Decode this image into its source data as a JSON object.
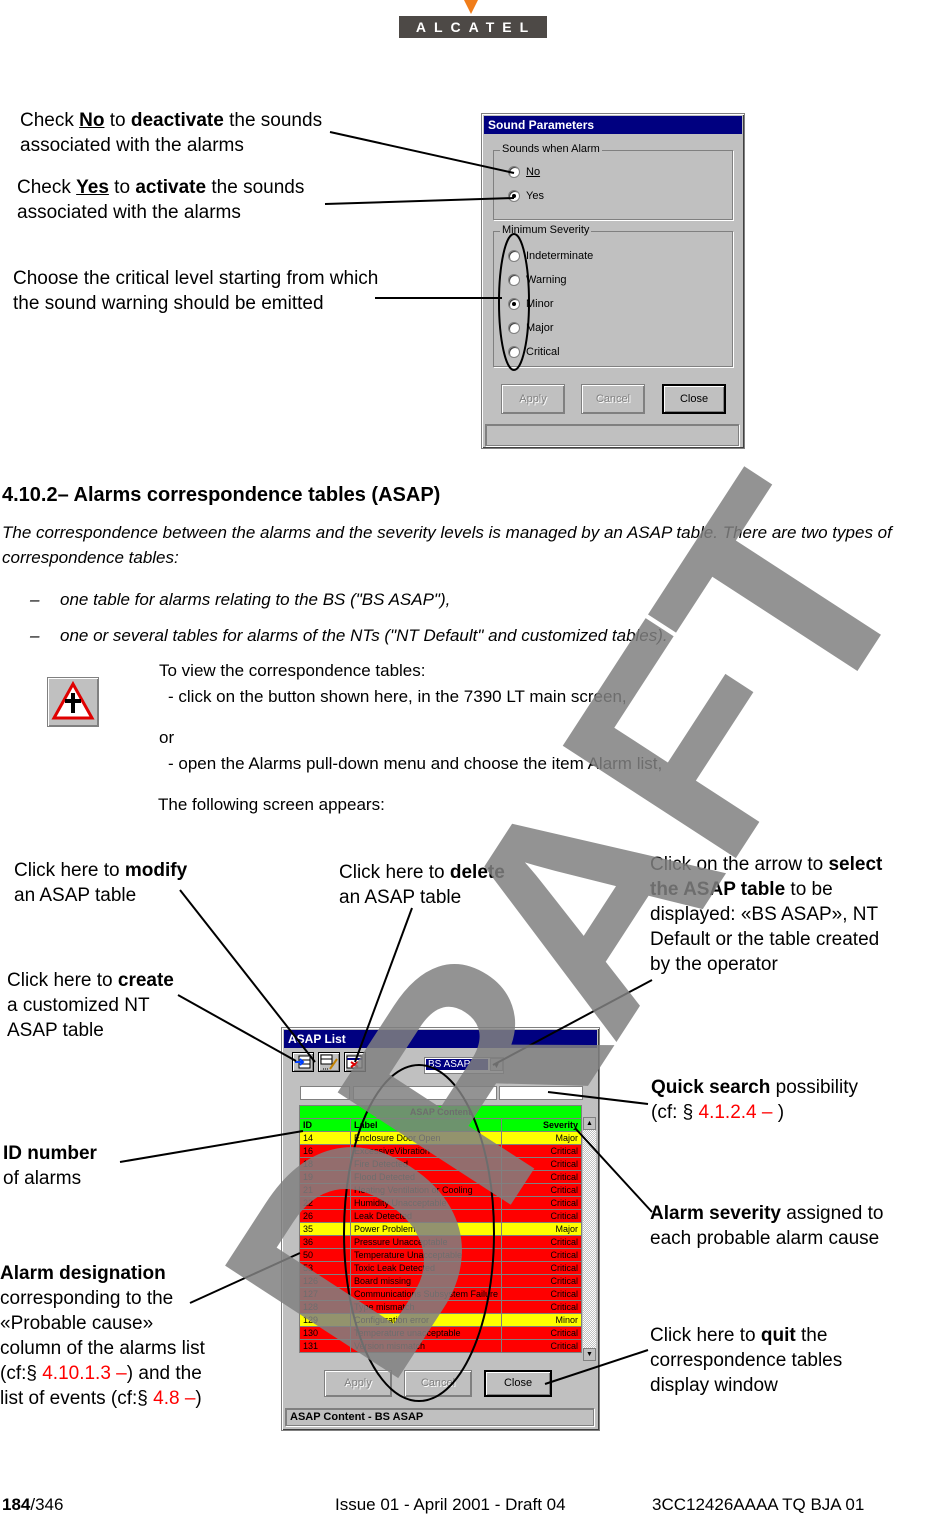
{
  "header": {
    "logo_text": "ALCATEL"
  },
  "sound_parameters_window": {
    "title": "Sound Parameters",
    "sounds_group_label": "Sounds when Alarm",
    "sounds_options": [
      {
        "label": "No",
        "selected": false
      },
      {
        "label": "Yes",
        "selected": true
      }
    ],
    "severity_group_label": "Minimum Severity",
    "severity_options": [
      {
        "label": "Indeterminate",
        "selected": false
      },
      {
        "label": "Warning",
        "selected": false
      },
      {
        "label": "Minor",
        "selected": true
      },
      {
        "label": "Major",
        "selected": false
      },
      {
        "label": "Critical",
        "selected": false
      }
    ],
    "buttons": {
      "apply": "Apply",
      "cancel": "Cancel",
      "close": "Close"
    },
    "status_text": ""
  },
  "callouts_top": {
    "no": {
      "pre": "Check ",
      "key": "No",
      "mid": " to ",
      "bold": "deactivate",
      "post": " the sounds",
      "line2": "associated with the alarms"
    },
    "yes": {
      "pre": "Check ",
      "key": "Yes",
      "mid": " to ",
      "bold": "activate",
      "post": " the sounds",
      "line2": "associated with the alarms"
    },
    "level": {
      "line1": "Choose the critical level starting from which",
      "line2": "the sound warning should be emitted"
    }
  },
  "section": {
    "heading": "4.10.2– Alarms correspondence tables (ASAP)",
    "intro": "The correspondence between the alarms and the severity levels is managed by an ASAP table. There are two types of correspondence tables:",
    "bullets": [
      "one table for alarms relating to the BS (\"BS ASAP\"),",
      "one or several tables for alarms of the NTs (\"NT Default\" and customized tables)."
    ],
    "bullet_dash": "–",
    "instructions": {
      "line1": "To view the correspondence tables:",
      "line2": "- click on the button shown here, in the 7390 LT main screen,",
      "or": "or",
      "line3": "- open the Alarms pull-down menu and choose the item Alarm list,",
      "line4": "The following screen appears:"
    }
  },
  "callouts_bottom": {
    "modify": {
      "pre": "Click here to ",
      "bold": "modify",
      "line2": "an ASAP table"
    },
    "delete": {
      "pre": "Click here to ",
      "bold": "delete",
      "line2": "an ASAP table"
    },
    "create": {
      "pre": "Click here to ",
      "bold": "create",
      "line2": "a customized NT",
      "line3": "ASAP table"
    },
    "select": {
      "pre": "Click on the arrow to ",
      "bold1": "select",
      "bold2": "the ASAP table",
      "post2": " to be",
      "line3": "displayed: «BS ASAP», NT",
      "line4": "Default or the table created",
      "line5": "by the operator"
    },
    "quick": {
      "bold": "Quick search",
      "post": " possibility",
      "line2_pre": "(cf: § ",
      "ref": "4.1.2.4 –",
      "line2_post": " )"
    },
    "id": {
      "bold": "ID number",
      "line2": "of alarms"
    },
    "severity": {
      "bold": "Alarm severity",
      "post": "  assigned to",
      "line2": "each probable alarm cause"
    },
    "designation": {
      "bold": "Alarm designation",
      "line2": "corresponding to the",
      "line3": "«Probable cause»",
      "line4": "column of the alarms list",
      "line5_pre": "(cf:§ ",
      "ref1": "4.10.1.3 –",
      "line5_post": ") and the",
      "line6_pre": "list of events (cf:§ ",
      "ref2": "4.8 –",
      "line6_post": ")"
    },
    "quit": {
      "pre": "Click here to ",
      "bold": "quit",
      "post": " the",
      "line2": "correspondence tables",
      "line3": "display window"
    }
  },
  "asap_window": {
    "title": "ASAP List",
    "dropdown_value": "BS ASAP",
    "search_fields": [
      "",
      "",
      ""
    ],
    "table_title": "ASAP Content",
    "columns": [
      "ID",
      "Label",
      "Severity"
    ],
    "rows": [
      {
        "id": "14",
        "label": "Enclosure Door Open",
        "severity": "Major"
      },
      {
        "id": "16",
        "label": "ExcessiveVibration",
        "severity": "Critical"
      },
      {
        "id": "18",
        "label": "Fire Detected",
        "severity": "Critical"
      },
      {
        "id": "19",
        "label": "Flood Detected",
        "severity": "Critical"
      },
      {
        "id": "21",
        "label": "Heating Ventilation or Cooling",
        "severity": "Critical"
      },
      {
        "id": "22",
        "label": "Humidity Unacceptable",
        "severity": "Critical"
      },
      {
        "id": "26",
        "label": "Leak Detected",
        "severity": "Critical"
      },
      {
        "id": "35",
        "label": "Power Problem",
        "severity": "Major"
      },
      {
        "id": "36",
        "label": "Pressure Unacceptable",
        "severity": "Critical"
      },
      {
        "id": "50",
        "label": "Temperature Unacceptable",
        "severity": "Critical"
      },
      {
        "id": "53",
        "label": "Toxic Leak Detected",
        "severity": "Critical"
      },
      {
        "id": "126",
        "label": "Board missing",
        "severity": "Critical"
      },
      {
        "id": "127",
        "label": "Communications Subsystem Failure",
        "severity": "Critical"
      },
      {
        "id": "128",
        "label": "Type mismatch",
        "severity": "Critical"
      },
      {
        "id": "129",
        "label": "Configuration error",
        "severity": "Minor"
      },
      {
        "id": "130",
        "label": "Temperature unacceptable",
        "severity": "Critical"
      },
      {
        "id": "131",
        "label": "Version mismatch",
        "severity": "Critical"
      }
    ],
    "severity_colors": {
      "Critical": "#ff0000",
      "Major": "#ffff00",
      "Minor": "#ffff00"
    },
    "header_color": "#00ff00",
    "buttons": {
      "apply": "Apply",
      "cancel": "Cancel",
      "close": "Close"
    },
    "status_text": "ASAP Content - BS ASAP"
  },
  "watermark": "DRAFT",
  "footer": {
    "page_current": "184",
    "page_total": "/346",
    "issue": "Issue 01 - April 2001 - Draft 04",
    "doc_ref": "3CC12426AAAA TQ BJA 01"
  }
}
